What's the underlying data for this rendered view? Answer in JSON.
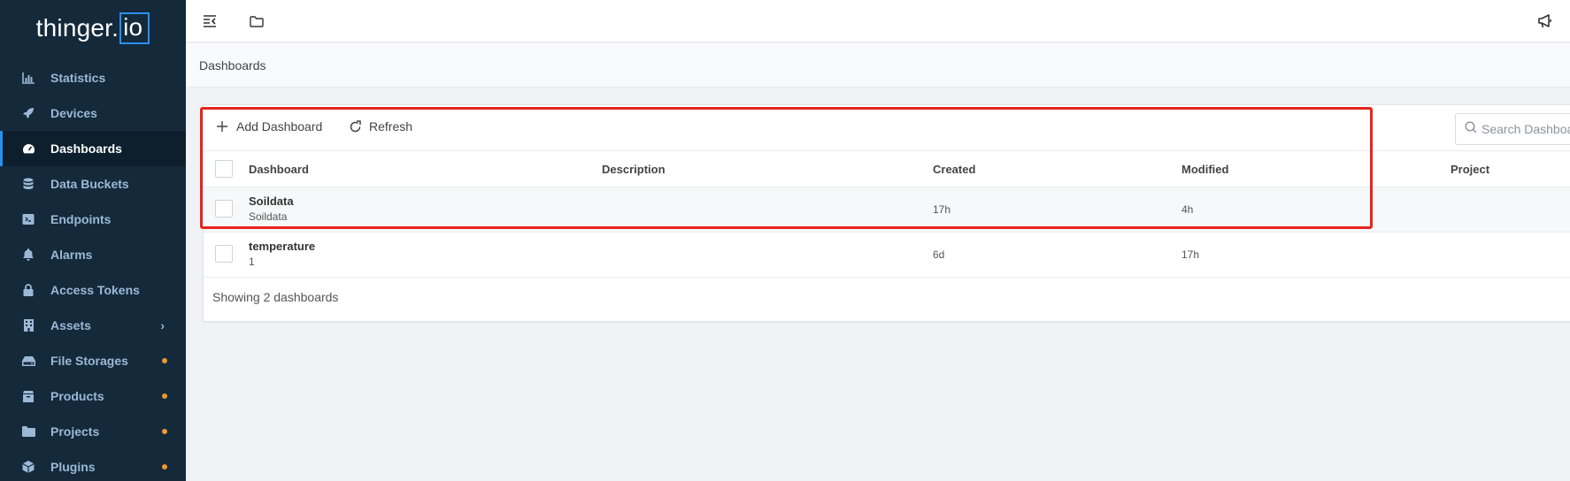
{
  "brand": {
    "name": "thinger.",
    "suffix": "io",
    "accent": "#2a8ff0"
  },
  "sidebar": {
    "items": [
      {
        "label": "Statistics",
        "icon": "chart-bar-icon",
        "active": false
      },
      {
        "label": "Devices",
        "icon": "rocket-icon",
        "active": false
      },
      {
        "label": "Dashboards",
        "icon": "gauge-icon",
        "active": true
      },
      {
        "label": "Data Buckets",
        "icon": "database-icon",
        "active": false
      },
      {
        "label": "Endpoints",
        "icon": "endpoint-icon",
        "active": false
      },
      {
        "label": "Alarms",
        "icon": "bell-icon",
        "active": false
      },
      {
        "label": "Access Tokens",
        "icon": "lock-icon",
        "active": false
      },
      {
        "label": "Assets",
        "icon": "building-icon",
        "active": false,
        "submenu": true
      },
      {
        "label": "File Storages",
        "icon": "hdd-icon",
        "active": false,
        "badge": true
      },
      {
        "label": "Products",
        "icon": "box-icon",
        "active": false,
        "badge": true
      },
      {
        "label": "Projects",
        "icon": "folder-icon",
        "active": false,
        "badge": true
      },
      {
        "label": "Plugins",
        "icon": "cube-icon",
        "active": false,
        "badge": true
      }
    ],
    "badge_color": "#f0972e"
  },
  "breadcrumb": "Dashboards",
  "toolbar": {
    "add_label": "Add Dashboard",
    "refresh_label": "Refresh",
    "search_placeholder": "Search Dashboards"
  },
  "table": {
    "columns": [
      "Dashboard",
      "Description",
      "Created",
      "Modified",
      "Project"
    ],
    "rows": [
      {
        "name": "Soildata",
        "sub": "Soildata",
        "description": "",
        "created": "17h",
        "modified": "4h",
        "project": ""
      },
      {
        "name": "temperature",
        "sub": "1",
        "description": "",
        "created": "6d",
        "modified": "17h",
        "project": ""
      }
    ]
  },
  "footer": "Showing 2 dashboards",
  "highlight_color": "#e5251e"
}
